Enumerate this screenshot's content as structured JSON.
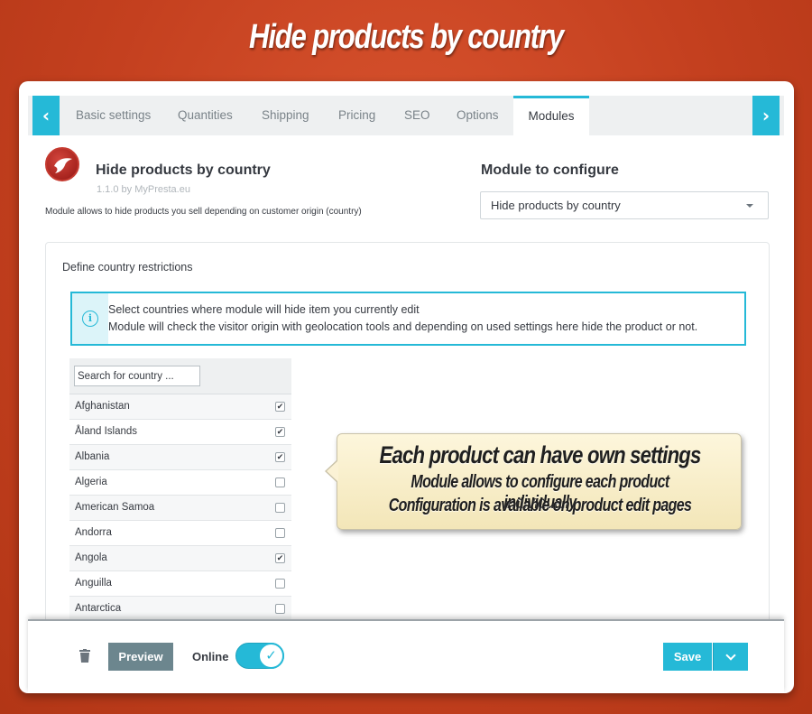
{
  "banner": {
    "title": "Hide products by country"
  },
  "tabs": {
    "items": [
      {
        "label": "Basic settings"
      },
      {
        "label": "Quantities"
      },
      {
        "label": "Shipping"
      },
      {
        "label": "Pricing"
      },
      {
        "label": "SEO"
      },
      {
        "label": "Options"
      },
      {
        "label": "Modules",
        "active": true
      }
    ],
    "prev_icon": "chevron-left-icon",
    "next_icon": "chevron-right-icon"
  },
  "module": {
    "name": "Hide products by country",
    "version": "1.1.0 by MyPresta.eu",
    "description": "Module allows to hide products you sell depending on customer origin (country)"
  },
  "configure": {
    "title": "Module to configure",
    "selected": "Hide products by country"
  },
  "restrictions": {
    "title": "Define country restrictions",
    "info_line_1": "Select countries where module will hide item you currently edit",
    "info_line_2": "Module will check the visitor origin with geolocation tools and depending on used settings here hide the product or not.",
    "search_placeholder": "Search for country ...",
    "countries": [
      {
        "name": "Afghanistan",
        "checked": true
      },
      {
        "name": "Åland Islands",
        "checked": true
      },
      {
        "name": "Albania",
        "checked": true
      },
      {
        "name": "Algeria",
        "checked": false
      },
      {
        "name": "American Samoa",
        "checked": false
      },
      {
        "name": "Andorra",
        "checked": false
      },
      {
        "name": "Angola",
        "checked": true
      },
      {
        "name": "Anguilla",
        "checked": false
      },
      {
        "name": "Antarctica",
        "checked": false
      }
    ]
  },
  "callout": {
    "line_1": "Each product can have own settings",
    "line_2": "Module allows to configure each product individually",
    "line_3": "Configuration is available on product edit pages"
  },
  "footer": {
    "preview_label": "Preview",
    "online_label": "Online",
    "online_enabled": true,
    "save_label": "Save"
  },
  "colors": {
    "accent": "#25b9d7",
    "background": "#c4401f",
    "preview_button": "#6c868e"
  }
}
